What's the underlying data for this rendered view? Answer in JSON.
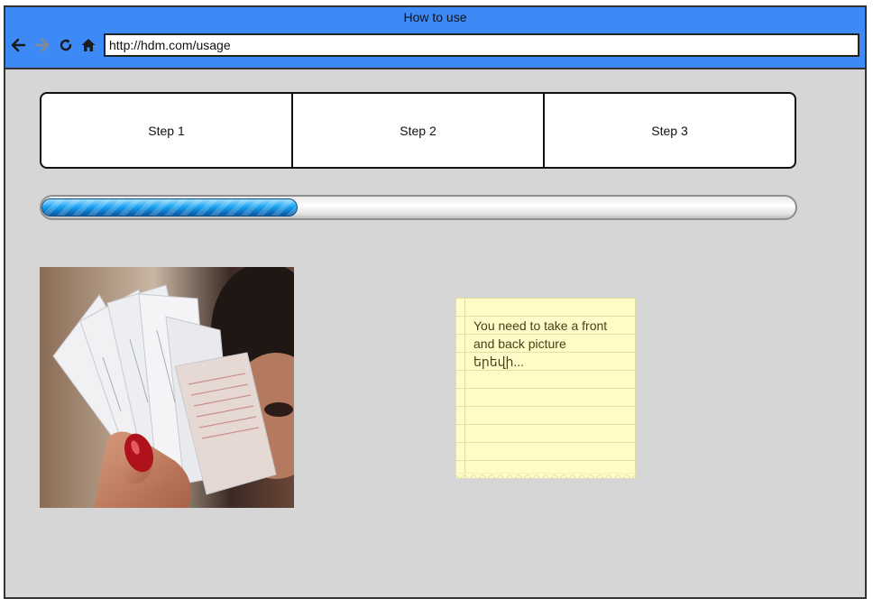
{
  "window": {
    "title": "How to use",
    "url": "http://hdm.com/usage",
    "nav": {
      "back_icon": "arrow-left-icon",
      "forward_icon": "arrow-right-icon",
      "reload_icon": "reload-icon",
      "home_icon": "home-icon"
    },
    "colors": {
      "titlebar": "#3d8af7",
      "canvas": "#d6d6d6"
    }
  },
  "steps": [
    {
      "label": "Step 1"
    },
    {
      "label": "Step 2"
    },
    {
      "label": "Step 3"
    }
  ],
  "progress": {
    "value": 0.34,
    "color": "#1aa5f2"
  },
  "photo": {
    "subject": "hand holding receipts"
  },
  "note": {
    "text": "You need to take a front and back picture\nերեվի..."
  }
}
